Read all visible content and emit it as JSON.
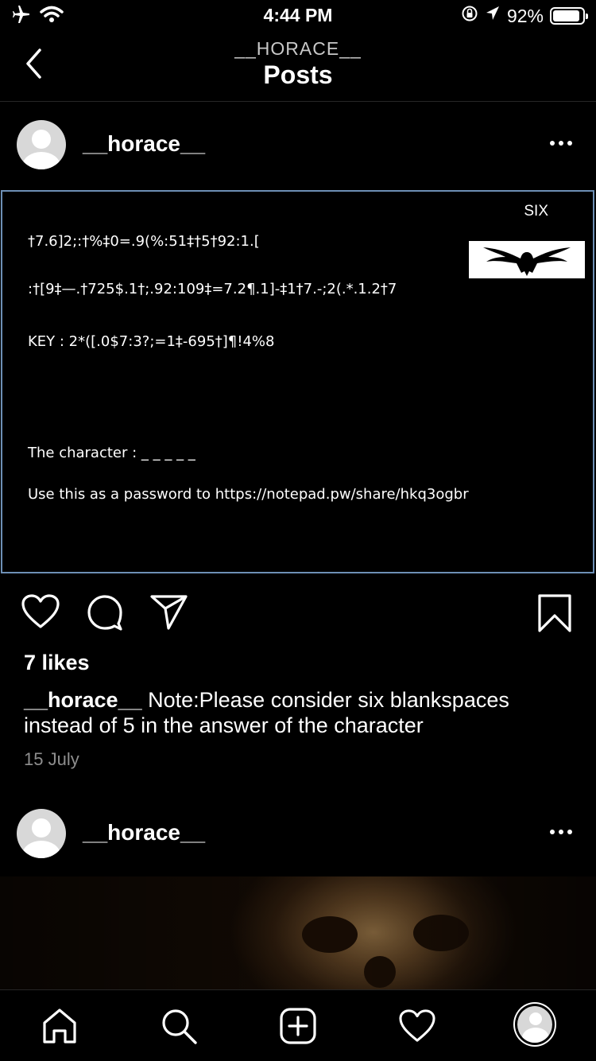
{
  "status_bar": {
    "time": "4:44 PM",
    "battery_text": "92%",
    "battery_level": 0.92,
    "icons": [
      "airplane-icon",
      "wifi-icon",
      "orientation-lock-icon",
      "location-icon",
      "battery-icon"
    ]
  },
  "nav": {
    "subtitle": "__HORACE__",
    "title": "Posts",
    "back_icon": "chevron-left-icon"
  },
  "post1": {
    "username": "__horace__",
    "image": {
      "corner_label": "SIX",
      "lines": [
        "†7.6]2;:†%‡0=.9(%:51‡†5†92:1.[",
        ":†[9‡—.†725$.1†;.92:109‡=7.2¶.1]-‡1†7.-;2(.*.1.2†7",
        "KEY : 2*([.0$7:3?;=1‡-695†]¶!4%8",
        "The character : _ _ _ _ _",
        "Use this as a password to https://notepad.pw/share/hkq3ogbr"
      ]
    },
    "likes": "7 likes",
    "caption_user": "__horace__",
    "caption_text": " Note:Please consider six blankspaces instead of 5 in the answer of the character",
    "date": "15 July"
  },
  "post2": {
    "username": "__horace__"
  },
  "tabbar": {
    "icons": [
      "home-icon",
      "search-icon",
      "new-post-icon",
      "activity-heart-icon",
      "profile-avatar"
    ]
  },
  "colors": {
    "background": "#000000",
    "frame_border": "#6d8fb5",
    "muted_text": "#8e8e8e",
    "divider": "#262626"
  }
}
